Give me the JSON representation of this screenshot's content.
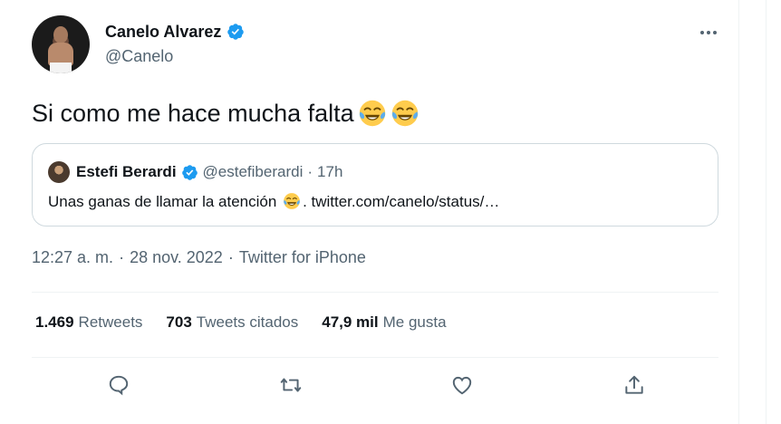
{
  "tweet": {
    "author": {
      "display_name": "Canelo Alvarez",
      "handle": "@Canelo",
      "verified": true,
      "avatar_icon": "boxer-avatar"
    },
    "text": "Si como me hace mucha falta",
    "text_emojis": [
      "tears-of-joy-emoji",
      "tears-of-joy-emoji"
    ],
    "quote": {
      "display_name": "Estefi Berardi",
      "handle": "@estefiberardi",
      "separator": "·",
      "time": "17h",
      "text_before_emoji": "Unas ganas de llamar la atención",
      "emoji": "tears-of-joy-emoji",
      "text_after_emoji": ". twitter.com/canelo/status/…"
    },
    "meta": {
      "time": "12:27 a. m.",
      "sep1": "·",
      "date": "28 nov. 2022",
      "sep2": "·",
      "source": "Twitter for iPhone"
    },
    "stats": {
      "retweets_count": "1.469",
      "retweets_label": "Retweets",
      "quotes_count": "703",
      "quotes_label": "Tweets citados",
      "likes_count": "47,9 mil",
      "likes_label": "Me gusta"
    },
    "actions": [
      "reply-icon",
      "retweet-icon",
      "like-icon",
      "share-icon"
    ]
  },
  "colors": {
    "verified": "#1d9bf0",
    "secondary_text": "#536471",
    "border": "#cfd9de",
    "divider": "#eff3f4"
  }
}
